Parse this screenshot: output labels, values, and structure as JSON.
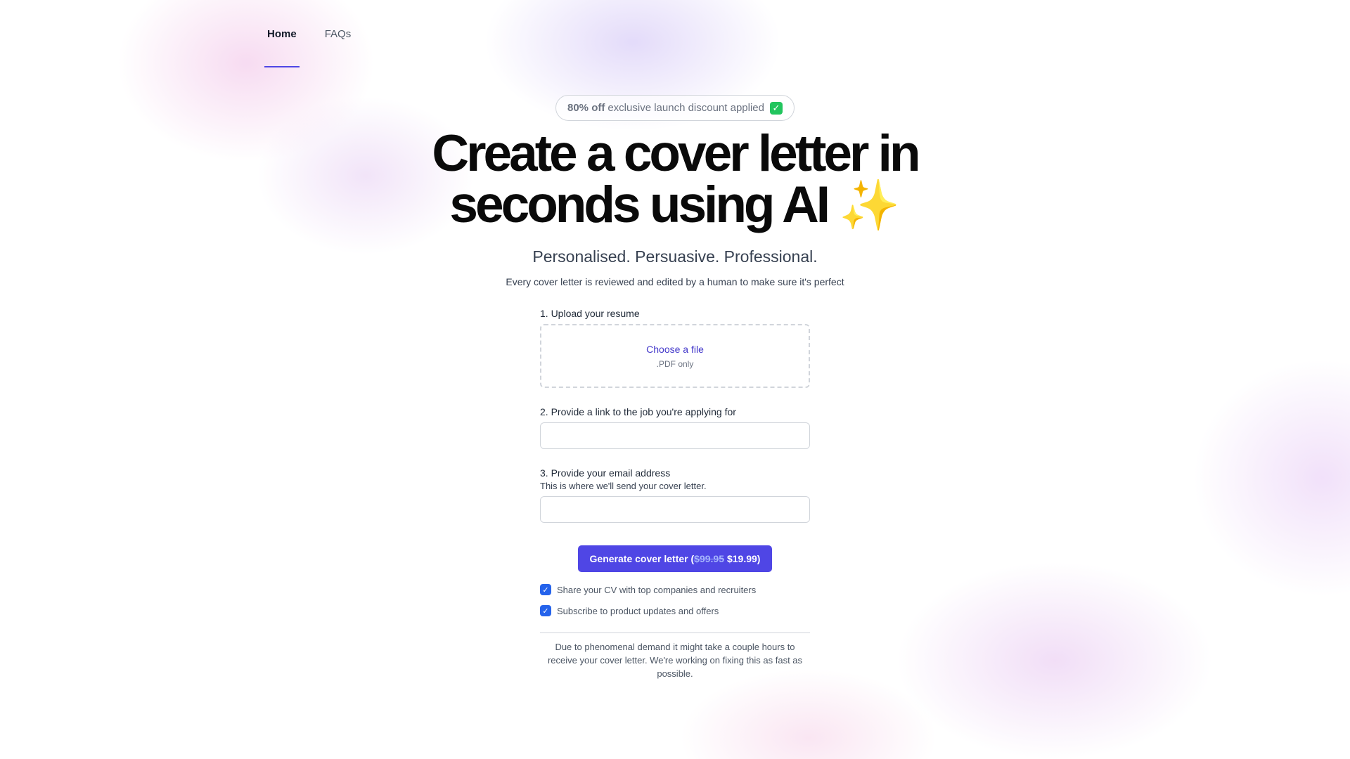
{
  "nav": {
    "items": [
      {
        "label": "Home",
        "active": true
      },
      {
        "label": "FAQs",
        "active": false
      }
    ]
  },
  "hero": {
    "badge_bold": "80% off",
    "badge_text": "exclusive launch discount applied",
    "badge_icon": "check-mark-button-emoji",
    "title_line1": "Create a cover letter in",
    "title_line2": "seconds using AI",
    "title_icon": "sparkles-emoji",
    "subtitle": "Personalised. Persuasive. Professional.",
    "description": "Every cover letter is reviewed and edited by a human to make sure it's perfect"
  },
  "form": {
    "step1_label": "1. Upload your resume",
    "upload_link": "Choose a file",
    "upload_note": ".PDF only",
    "step2_label": "2. Provide a link to the job you're applying for",
    "job_link_value": "",
    "step3_label": "3. Provide your email address",
    "step3_hint": "This is where we'll send your cover letter.",
    "email_value": "",
    "button_prefix": "Generate cover letter (",
    "button_old_price": "$99.95",
    "button_new_price": "$19.99)",
    "checkboxes": [
      {
        "label": "Share your CV with top companies and recruiters",
        "checked": true
      },
      {
        "label": "Subscribe to product updates and offers",
        "checked": true
      }
    ],
    "notice": "Due to phenomenal demand it might take a couple hours to receive your cover letter. We're working on fixing this as fast as possible."
  },
  "colors": {
    "accent": "#4f46e5",
    "checkbox": "#2563eb",
    "link": "#4338ca"
  }
}
